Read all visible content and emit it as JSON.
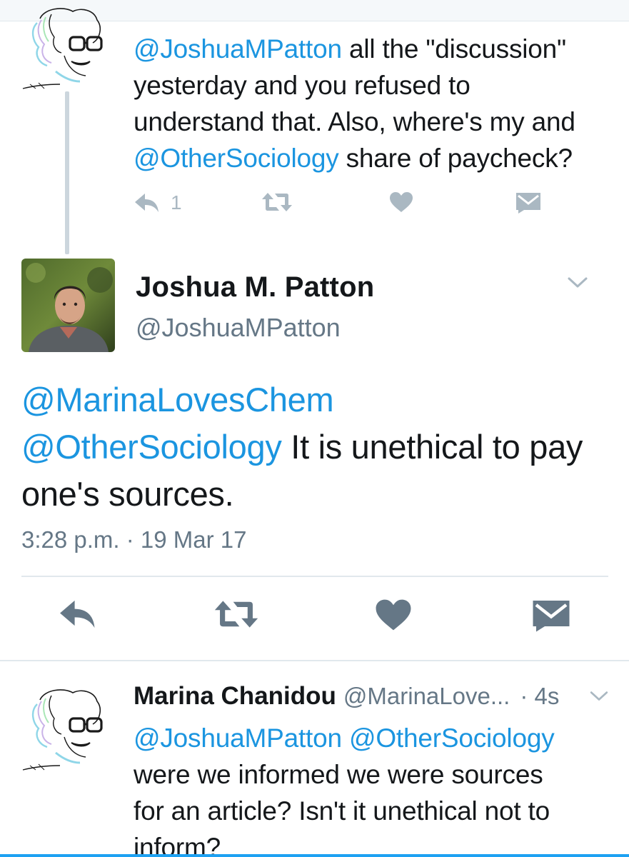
{
  "colors": {
    "mention": "#1b95e0",
    "text": "#14171a",
    "secondary": "#657786",
    "action_icon": "#aab8c2",
    "action_icon_focused": "#657786",
    "divider": "#e1e8ed"
  },
  "parent_tweet": {
    "avatar": "sketch-avatar-icon",
    "lines": [
      [
        {
          "mention": "@JoshuaMPatton"
        },
        {
          "text": " all the \"discussion\""
        }
      ],
      [
        {
          "text": "yesterday and you refused to"
        }
      ],
      [
        {
          "text": "understand that. Also, where's my and"
        }
      ],
      [
        {
          "mention": "@OtherSociology"
        },
        {
          "text": " share of paycheck?"
        }
      ]
    ],
    "reply_count": "1",
    "icons": [
      "reply-icon",
      "retweet-icon",
      "heart-icon",
      "envelope-icon"
    ]
  },
  "focused_tweet": {
    "author_name": "Joshua M. Patton",
    "author_handle": "@JoshuaMPatton",
    "lines": [
      [
        {
          "mention": "@MarinaLovesChem"
        }
      ],
      [
        {
          "mention": "@OtherSociology"
        },
        {
          "text": " It is unethical to pay"
        }
      ],
      [
        {
          "text": "one's sources."
        }
      ]
    ],
    "timestamp": "3:28 p.m. · 19 Mar 17",
    "icons": [
      "reply-icon",
      "retweet-icon",
      "heart-icon",
      "envelope-icon",
      "chevron-down-icon"
    ]
  },
  "reply_tweet": {
    "author_name": "Marina Chanidou",
    "author_handle": "@MarinaLove...",
    "time": "· 4s",
    "lines": [
      [
        {
          "mention": "@JoshuaMPatton"
        },
        {
          "text": " "
        },
        {
          "mention": "@OtherSociology"
        }
      ],
      [
        {
          "text": "were we informed we were sources"
        }
      ],
      [
        {
          "text": "for an article? Isn't it unethical not to"
        }
      ],
      [
        {
          "text": "inform?"
        }
      ]
    ]
  }
}
